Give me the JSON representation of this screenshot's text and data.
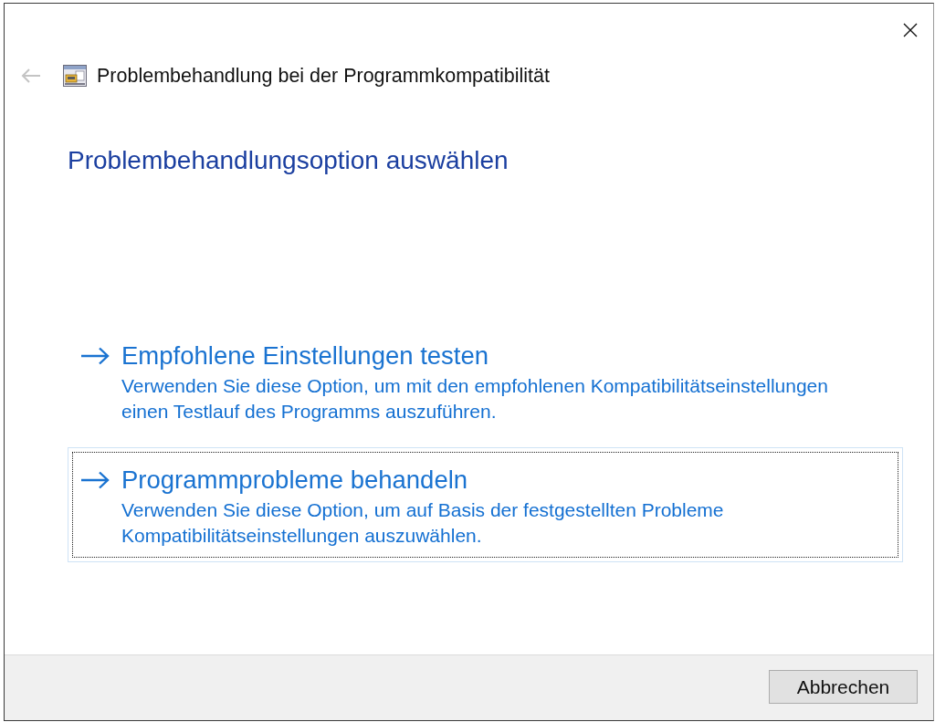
{
  "window": {
    "title": "Problembehandlung bei der Programmkompatibilität"
  },
  "back_button": {
    "disabled": true
  },
  "heading": "Problembehandlungsoption auswählen",
  "options": [
    {
      "title": "Empfohlene Einstellungen testen",
      "description": "Verwenden Sie diese Option, um mit den empfohlenen Kompatibilitätseinstellungen einen Testlauf des Programms auszuführen.",
      "focused": false
    },
    {
      "title": "Programmprobleme behandeln",
      "description": "Verwenden Sie diese Option, um auf Basis der festgestellten Probleme Kompatibilitätseinstellungen auszuwählen.",
      "focused": true
    }
  ],
  "buttons": [
    "Abbrechen"
  ]
}
